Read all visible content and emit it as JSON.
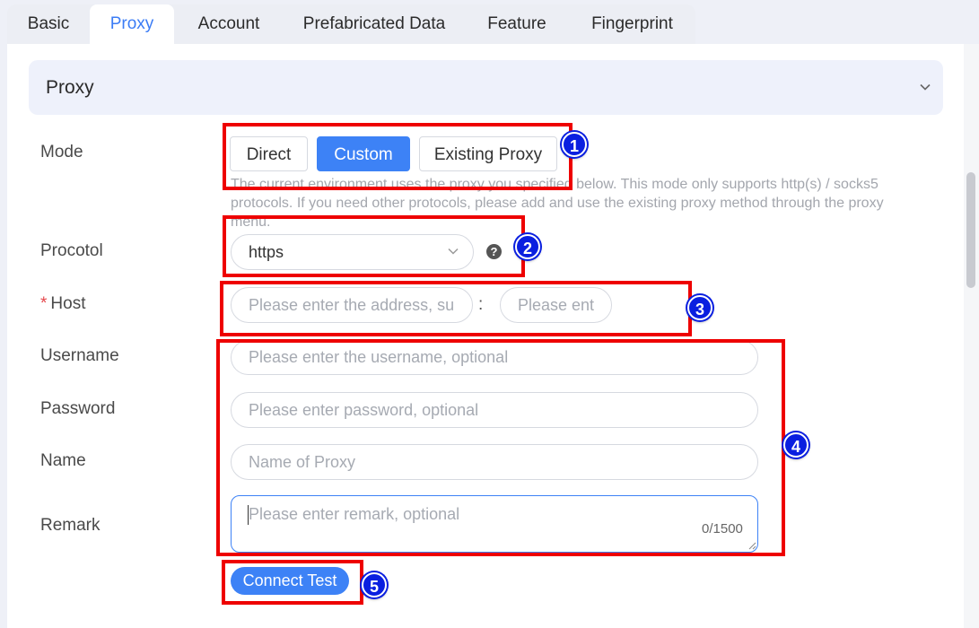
{
  "tabs": [
    {
      "label": "Basic",
      "active": false
    },
    {
      "label": "Proxy",
      "active": true
    },
    {
      "label": "Account",
      "active": false
    },
    {
      "label": "Prefabricated Data",
      "active": false
    },
    {
      "label": "Feature",
      "active": false
    },
    {
      "label": "Fingerprint",
      "active": false
    }
  ],
  "section": {
    "title": "Proxy",
    "icon": "chevron-down-icon"
  },
  "form": {
    "mode": {
      "label": "Mode",
      "options": [
        "Direct",
        "Custom",
        "Existing Proxy"
      ],
      "selected": "Custom",
      "description": "The current environment uses the proxy you specified below. This mode only supports http(s) / socks5 protocols. If you need other protocols, please add and use the existing proxy method through the proxy menu."
    },
    "protocol": {
      "label": "Procotol",
      "value": "https",
      "help_icon": "question-circle-icon"
    },
    "host": {
      "required_mark": "*",
      "label": "Host",
      "address_placeholder": "Please enter the address, sup",
      "separator": ":",
      "port_placeholder": "Please ente"
    },
    "username": {
      "label": "Username",
      "placeholder": "Please enter the username, optional"
    },
    "password": {
      "label": "Password",
      "placeholder": "Please enter password, optional"
    },
    "name": {
      "label": "Name",
      "placeholder": "Name of Proxy"
    },
    "remark": {
      "label": "Remark",
      "placeholder": "Please enter remark, optional",
      "counter": "0/1500"
    },
    "connect_test_label": "Connect Test"
  },
  "annotations": [
    "1",
    "2",
    "3",
    "4",
    "5"
  ],
  "colors": {
    "accent": "#3d82f6",
    "highlight": "#ee0000",
    "badge": "#0a1fe0"
  }
}
